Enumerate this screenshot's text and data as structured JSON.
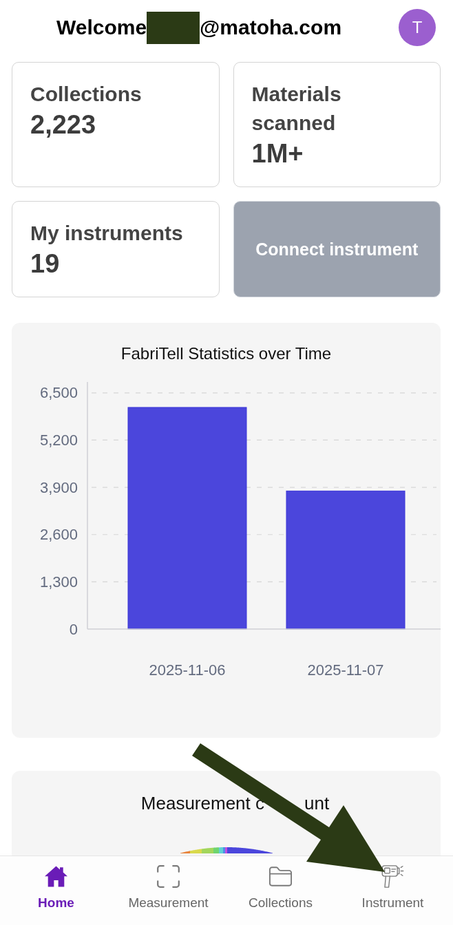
{
  "header": {
    "welcome": [
      {
        "kind": "greeting",
        "text": "Welcome"
      },
      {
        "kind": "redaction"
      },
      {
        "kind": "email",
        "text": "@matoha.com"
      }
    ],
    "avatar": {
      "initial": "T"
    }
  },
  "cards": [
    {
      "kind": "stat",
      "label": "Collections",
      "value": "2,223"
    },
    {
      "kind": "stat",
      "label": "Materials scanned",
      "value": "1M+"
    },
    {
      "kind": "stat",
      "label": "My instruments",
      "value": "19"
    },
    {
      "kind": "action",
      "label": "Connect instrument"
    }
  ],
  "statistics_chart": {
    "chart_data": {
      "type": "bar",
      "title": "FabriTell Statistics over Time",
      "categories": [
        "2025-11-06",
        "2025-11-07"
      ],
      "values": [
        6100,
        3800
      ],
      "ylim": [
        0,
        6800
      ],
      "grid": true,
      "yticks": [
        {
          "value": 0,
          "label": "0"
        },
        {
          "value": 1300,
          "label": "1,300"
        },
        {
          "value": 2600,
          "label": "2,600"
        },
        {
          "value": 3900,
          "label": "3,900"
        },
        {
          "value": 5200,
          "label": "5,200"
        },
        {
          "value": 6500,
          "label": "6,500"
        }
      ]
    }
  },
  "measurement_chart": {
    "title_visible_parts": [
      "Measurement c",
      "unt"
    ]
  },
  "annotations": [
    {
      "kind": "arrow"
    }
  ],
  "bottom_nav": [
    {
      "label": "Home",
      "selected": true
    },
    {
      "label": "Measurement",
      "selected": false
    },
    {
      "label": "Collections",
      "selected": false
    },
    {
      "label": "Instrument",
      "selected": false
    }
  ]
}
